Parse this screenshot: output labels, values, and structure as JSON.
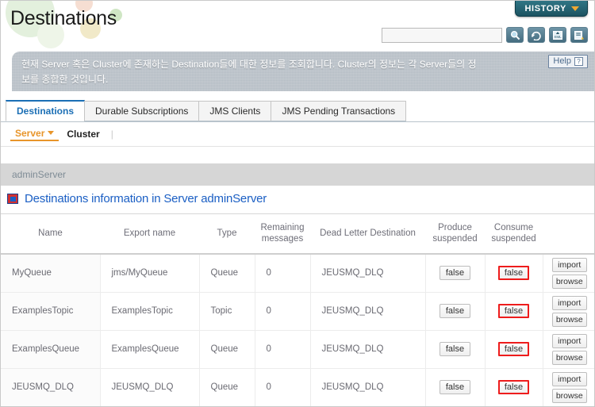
{
  "header": {
    "page_title": "Destinations",
    "history_label": "HISTORY",
    "history_caret_icon": "chevron-down-icon",
    "search_value": "",
    "search_placeholder": "",
    "toolbar_icons": [
      {
        "name": "search-icon",
        "glyph": "⌕"
      },
      {
        "name": "refresh-icon",
        "glyph": "↻"
      },
      {
        "name": "export-xml-icon",
        "glyph": "XML"
      },
      {
        "name": "export-excel-icon",
        "glyph": "⤓"
      }
    ]
  },
  "description": {
    "line1": "현재 Server 혹은 Cluster에 존재하는 Destination들에 대한 정보를 조회합니다. Cluster의 정보는 각 Server들의 정",
    "line2": "보를 종합한 것입니다.",
    "help_label": "Help",
    "help_icon_glyph": "?"
  },
  "tabs": [
    {
      "label": "Destinations",
      "active": true
    },
    {
      "label": "Durable Subscriptions",
      "active": false
    },
    {
      "label": "JMS Clients",
      "active": false
    },
    {
      "label": "JMS Pending Transactions",
      "active": false
    }
  ],
  "subnav": {
    "items": [
      {
        "label": "Server",
        "active": true,
        "caret_icon": "caret-down-icon"
      },
      {
        "label": "Cluster",
        "active": false
      }
    ],
    "separator": "|"
  },
  "server_bar": {
    "name": "adminServer"
  },
  "section": {
    "icon": "destinations-icon",
    "title": "Destinations information in Server adminServer"
  },
  "table": {
    "columns": [
      "Name",
      "Export name",
      "Type",
      "Remaining messages",
      "Dead Letter Destination",
      "Produce suspended",
      "Consume suspended",
      ""
    ],
    "rows": [
      {
        "name": "MyQueue",
        "export_name": "jms/MyQueue",
        "type": "Queue",
        "remaining_messages": "0",
        "dead_letter_destination": "JEUSMQ_DLQ",
        "produce_suspended": "false",
        "consume_suspended": "false",
        "consume_alert": true,
        "actions": [
          "import",
          "browse"
        ]
      },
      {
        "name": "ExamplesTopic",
        "export_name": "ExamplesTopic",
        "type": "Topic",
        "remaining_messages": "0",
        "dead_letter_destination": "JEUSMQ_DLQ",
        "produce_suspended": "false",
        "consume_suspended": "false",
        "consume_alert": true,
        "actions": [
          "import",
          "browse"
        ]
      },
      {
        "name": "ExamplesQueue",
        "export_name": "ExamplesQueue",
        "type": "Queue",
        "remaining_messages": "0",
        "dead_letter_destination": "JEUSMQ_DLQ",
        "produce_suspended": "false",
        "consume_suspended": "false",
        "consume_alert": true,
        "actions": [
          "import",
          "browse"
        ]
      },
      {
        "name": "JEUSMQ_DLQ",
        "export_name": "JEUSMQ_DLQ",
        "type": "Queue",
        "remaining_messages": "0",
        "dead_letter_destination": "JEUSMQ_DLQ",
        "produce_suspended": "false",
        "consume_suspended": "false",
        "consume_alert": true,
        "actions": [
          "import",
          "browse"
        ]
      }
    ]
  },
  "colors": {
    "accent_blue": "#1b5fc4",
    "tab_active": "#1b6fb5",
    "subnav_active": "#e8952a",
    "alert_red": "#ee1c1c",
    "history_bg": "#2f7585",
    "banner_bg": "#b4bcc4"
  }
}
